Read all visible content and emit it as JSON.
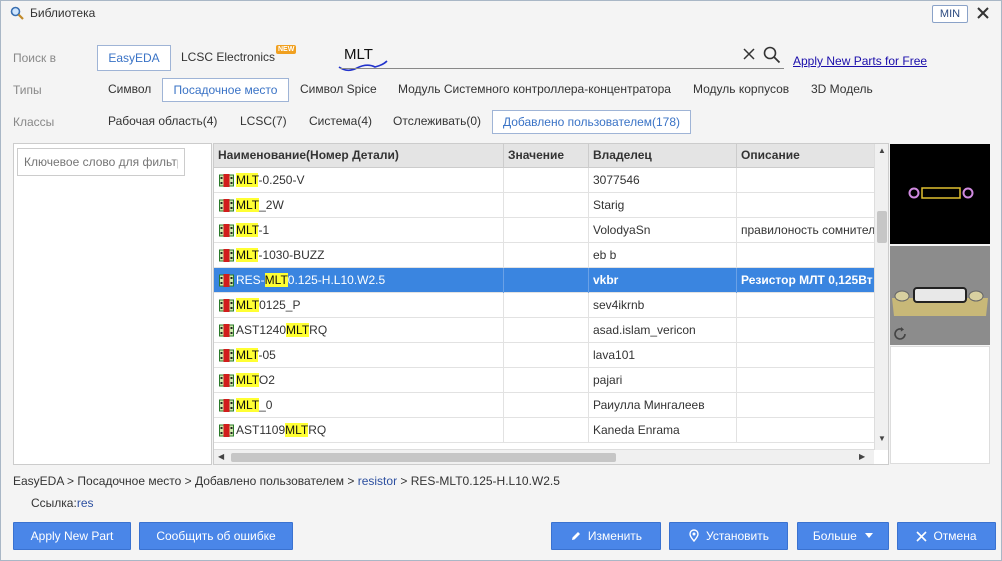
{
  "window": {
    "title": "Библиотека",
    "min_label": "MIN"
  },
  "search": {
    "label": "Поиск в",
    "sources": [
      {
        "label": "EasyEDA",
        "active": true
      },
      {
        "label": "LCSC Electronics",
        "badge": "NEW",
        "active": false
      }
    ],
    "query": "MLT",
    "apply_link": "Apply New Parts for Free"
  },
  "types": {
    "label": "Типы",
    "items": [
      "Символ",
      "Посадочное место",
      "Символ Spice",
      "Модуль Системного контроллера-концентратора",
      "Модуль корпусов",
      "3D Модель"
    ],
    "active_index": 1
  },
  "classes": {
    "label": "Классы",
    "items": [
      "Рабочая область(4)",
      "LCSC(7)",
      "Система(4)",
      "Отслеживать(0)",
      "Добавлено пользователем(178)"
    ],
    "active_index": 4
  },
  "filter": {
    "placeholder": "Ключевое слово для фильтра"
  },
  "table": {
    "columns": [
      "Наименование(Номер Детали)",
      "Значение",
      "Владелец",
      "Описание"
    ],
    "rows": [
      {
        "name": [
          "",
          "MLT",
          "-0.250-V"
        ],
        "value": "",
        "owner": "3077546",
        "description": ""
      },
      {
        "name": [
          "",
          "MLT",
          "_2W"
        ],
        "value": "",
        "owner": "Starig",
        "description": ""
      },
      {
        "name": [
          "",
          "MLT",
          "-1"
        ],
        "value": "",
        "owner": "VolodyaSn",
        "description": "правилоность сомнител"
      },
      {
        "name": [
          "",
          "MLT",
          "-1030-BUZZ"
        ],
        "value": "",
        "owner": "eb b",
        "description": ""
      },
      {
        "name": [
          "RES-",
          "MLT",
          "0.125-H.L10.W2.5"
        ],
        "value": "",
        "owner": "vkbr",
        "description": "Резистор МЛТ 0,125Вт /",
        "selected": true
      },
      {
        "name": [
          "",
          "MLT",
          "0125_P"
        ],
        "value": "",
        "owner": "sev4ikrnb",
        "description": ""
      },
      {
        "name": [
          "AST1240",
          "MLT",
          "RQ"
        ],
        "value": "",
        "owner": "asad.islam_vericon",
        "description": ""
      },
      {
        "name": [
          "",
          "MLT",
          "-05"
        ],
        "value": "",
        "owner": "lava101",
        "description": ""
      },
      {
        "name": [
          "",
          "MLT",
          "O2"
        ],
        "value": "",
        "owner": "pajari",
        "description": ""
      },
      {
        "name": [
          "",
          "MLT",
          "_0"
        ],
        "value": "",
        "owner": "Раиулла Мингалеев",
        "description": ""
      },
      {
        "name": [
          "AST1109",
          "MLT",
          "RQ"
        ],
        "value": "",
        "owner": "Kaneda Enrama",
        "description": ""
      }
    ]
  },
  "breadcrumb": {
    "parts": [
      "EasyEDA",
      "Посадочное место",
      "Добавлено пользователем",
      "resistor",
      "RES-MLT0.125-H.L10.W2.5"
    ],
    "separator": " > "
  },
  "reference": {
    "label": "Ссылка:",
    "value": "res"
  },
  "buttons": {
    "apply_new_part": "Apply New Part",
    "report_error": "Сообщить об ошибке",
    "edit": "Изменить",
    "install": "Установить",
    "more": "Больше",
    "cancel": "Отмена"
  },
  "colors": {
    "accent": "#4a86e8",
    "selected_row": "#3a85e0",
    "highlight": "#ffff33"
  }
}
